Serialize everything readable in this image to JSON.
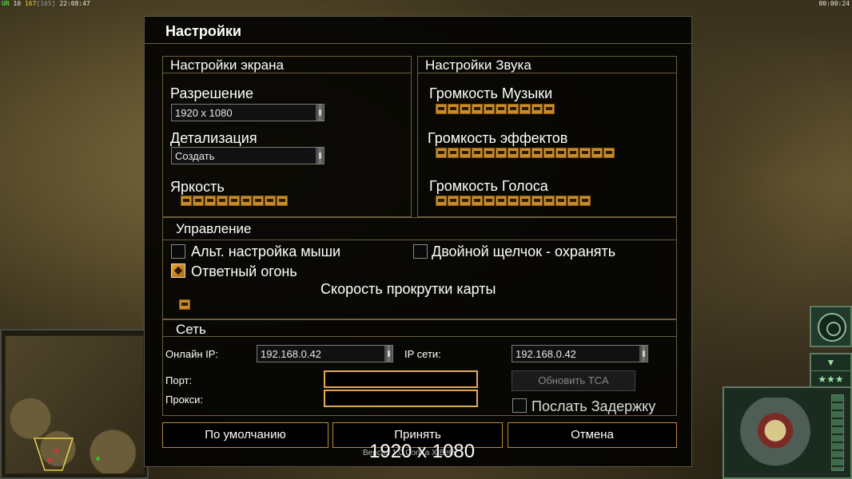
{
  "hud": {
    "left_a": "UR",
    "left_b": "10",
    "left_c": "167",
    "left_d": "[165]",
    "left_time": "22:08:47",
    "right_time": "00:00:24"
  },
  "dialog": {
    "title": "Настройки",
    "screen": {
      "header": "Настройки экрана",
      "resolution_label": "Разрешение",
      "resolution_value": "1920 x 1080",
      "detail_label": "Детализация",
      "detail_value": "Создать",
      "brightness_label": "Яркость",
      "brightness_level": 9
    },
    "sound": {
      "header": "Настройки Звука",
      "music_label": "Громкость Музыки",
      "music_level": 10,
      "effects_label": "Громкость эффектов",
      "effects_level": 15,
      "voice_label": "Громкость Голоса",
      "voice_level": 13
    },
    "controls": {
      "header": "Управление",
      "alt_mouse_label": "Альт. настройка мыши",
      "alt_mouse_checked": false,
      "double_click_label": "Двойной щелчок - охранять",
      "double_click_checked": false,
      "return_fire_label": "Ответный огонь",
      "return_fire_checked": true,
      "scroll_speed_label": "Скорость прокрутки карты",
      "scroll_speed_level": 1
    },
    "network": {
      "header": "Сеть",
      "online_ip_label": "Онлайн IP:",
      "online_ip_value": "192.168.0.42",
      "lan_ip_label": "IP сети:",
      "lan_ip_value": "192.168.0.42",
      "port_label": "Порт:",
      "port_value": "",
      "proxy_label": "Прокси:",
      "proxy_value": "",
      "update_tca_label": "Обновить TCA",
      "send_delay_label": "Послать Задержку",
      "send_delay_checked": false
    },
    "buttons": {
      "default": "По умолчанию",
      "accept": "Принять",
      "cancel": "Отмена"
    }
  },
  "overlay": {
    "resolution": "1920 x 1080",
    "version": "Версия 1.0  Contra X  Beta"
  },
  "side_hud": {
    "chevron": "▼",
    "stars": "★★★"
  },
  "colors": {
    "accent": "#c98a2a",
    "border": "#6a5d40"
  }
}
